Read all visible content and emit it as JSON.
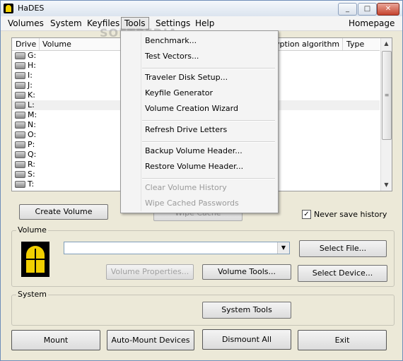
{
  "window": {
    "title": "HaDES",
    "controls": [
      "_",
      "□",
      "✕"
    ]
  },
  "menubar": {
    "items": [
      "Volumes",
      "System",
      "Keyfiles",
      "Tools",
      "Settings",
      "Help"
    ],
    "homepage": "Homepage"
  },
  "drive_list": {
    "headers": [
      "Drive",
      "Volume",
      "yption algorithm",
      "Type"
    ],
    "drives": [
      "G:",
      "H:",
      "I:",
      "J:",
      "K:",
      "L:",
      "M:",
      "N:",
      "O:",
      "P:",
      "Q:",
      "R:",
      "S:",
      "T:"
    ]
  },
  "tools_menu": {
    "items": [
      {
        "label": "Benchmark...",
        "enabled": true
      },
      {
        "label": "Test Vectors...",
        "enabled": true
      },
      {
        "label": "Traveler Disk Setup...",
        "enabled": true
      },
      {
        "label": "Keyfile Generator",
        "enabled": true
      },
      {
        "label": "Volume Creation Wizard",
        "enabled": true
      },
      {
        "label": "Refresh Drive Letters",
        "enabled": true
      },
      {
        "label": "Backup Volume Header...",
        "enabled": true
      },
      {
        "label": "Restore Volume Header...",
        "enabled": true
      },
      {
        "label": "Clear Volume History",
        "enabled": false
      },
      {
        "label": "Wipe Cached Passwords",
        "enabled": false
      }
    ]
  },
  "buttons": {
    "create_volume": "Create Volume",
    "wipe_cache": "Wipe Cache",
    "select_file": "Select File...",
    "volume_properties": "Volume Properties...",
    "volume_tools": "Volume Tools...",
    "select_device": "Select Device...",
    "system_tools": "System Tools",
    "mount": "Mount",
    "auto_mount": "Auto-Mount Devices",
    "dismount_all": "Dismount All",
    "exit": "Exit"
  },
  "never_save_history": {
    "label": "Never save history",
    "checked": true
  },
  "groups": {
    "volume": "Volume",
    "system": "System"
  },
  "volume_path": {
    "value": ""
  },
  "watermark": "SOFTPEDIA"
}
